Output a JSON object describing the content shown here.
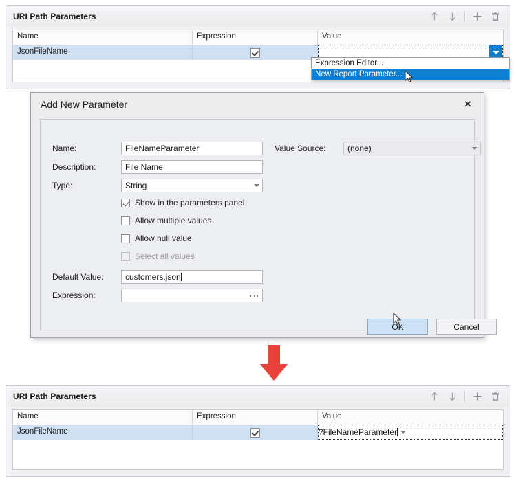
{
  "top_panel": {
    "title": "URI Path Parameters",
    "toolbar": [
      {
        "name": "move-up-icon",
        "glyph": "↑"
      },
      {
        "name": "move-down-icon",
        "glyph": "↓"
      },
      {
        "name": "add-icon",
        "glyph": "+"
      },
      {
        "name": "delete-icon",
        "glyph": "🗑"
      }
    ],
    "columns": [
      "Name",
      "Expression",
      "Value"
    ],
    "rows": [
      {
        "name": "JsonFileName",
        "expression_checked": true,
        "value": ""
      }
    ]
  },
  "dropdown": {
    "open": true,
    "items": [
      {
        "label": "Expression Editor...",
        "selected": false
      },
      {
        "label": "New Report Parameter...",
        "selected": true
      }
    ]
  },
  "dialog": {
    "title": "Add New Parameter",
    "close_label": "✕",
    "fields": {
      "name_label": "Name:",
      "name_value": "FileNameParameter",
      "description_label": "Description:",
      "description_value": "File Name",
      "type_label": "Type:",
      "type_value": "String",
      "value_source_label": "Value Source:",
      "value_source_value": "(none)",
      "default_value_label": "Default Value:",
      "default_value_value": "customers.json",
      "expression_label": "Expression:",
      "expression_value": "",
      "expression_button": "···"
    },
    "checkboxes": [
      {
        "label": "Show in the parameters panel",
        "checked": true,
        "disabled": false
      },
      {
        "label": "Allow multiple values",
        "checked": false,
        "disabled": false
      },
      {
        "label": "Allow null value",
        "checked": false,
        "disabled": false
      },
      {
        "label": "Select all values",
        "checked": false,
        "disabled": true
      }
    ],
    "buttons": {
      "ok": "OK",
      "cancel": "Cancel"
    }
  },
  "bottom_panel": {
    "title": "URI Path Parameters",
    "toolbar": [
      {
        "name": "move-up-icon",
        "glyph": "↑"
      },
      {
        "name": "move-down-icon",
        "glyph": "↓"
      },
      {
        "name": "add-icon",
        "glyph": "+"
      },
      {
        "name": "delete-icon",
        "glyph": "🗑"
      }
    ],
    "columns": [
      "Name",
      "Expression",
      "Value"
    ],
    "rows": [
      {
        "name": "JsonFileName",
        "expression_checked": true,
        "value": "?FileNameParameter"
      }
    ]
  },
  "annotation": {
    "arrow_color": "#e8403a",
    "direction": "down"
  },
  "colors": {
    "accent_blue": "#0f7fd1",
    "row_highlight": "#cfe0f2",
    "panel_bg": "#f1f1f4",
    "dialog_bg": "#edeef1",
    "primary_button": "#cde1f5"
  }
}
